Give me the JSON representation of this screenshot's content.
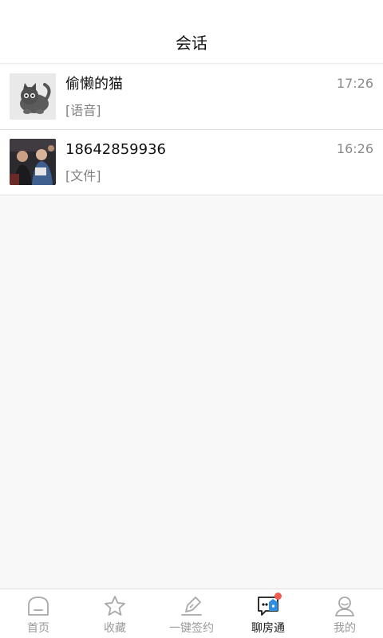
{
  "header": {
    "title": "会话"
  },
  "conversations": [
    {
      "name": "偷懒的猫",
      "time": "17:26",
      "preview": "[语音]",
      "avatar": "cat-avatar"
    },
    {
      "name": "18642859936",
      "time": "16:26",
      "preview": "[文件]",
      "avatar": "photo-avatar"
    }
  ],
  "tabbar": {
    "items": [
      {
        "label": "首页",
        "icon": "home-icon"
      },
      {
        "label": "收藏",
        "icon": "star-icon"
      },
      {
        "label": "一键签约",
        "icon": "sign-pen-icon"
      },
      {
        "label": "聊房通",
        "icon": "chat-icon",
        "active": true
      },
      {
        "label": "我的",
        "icon": "user-icon"
      }
    ]
  },
  "colors": {
    "active": "#1a1a1a",
    "inactive": "#9a9a9a",
    "chat_accent": "#2f8ee0",
    "badge": "#f05a50"
  }
}
